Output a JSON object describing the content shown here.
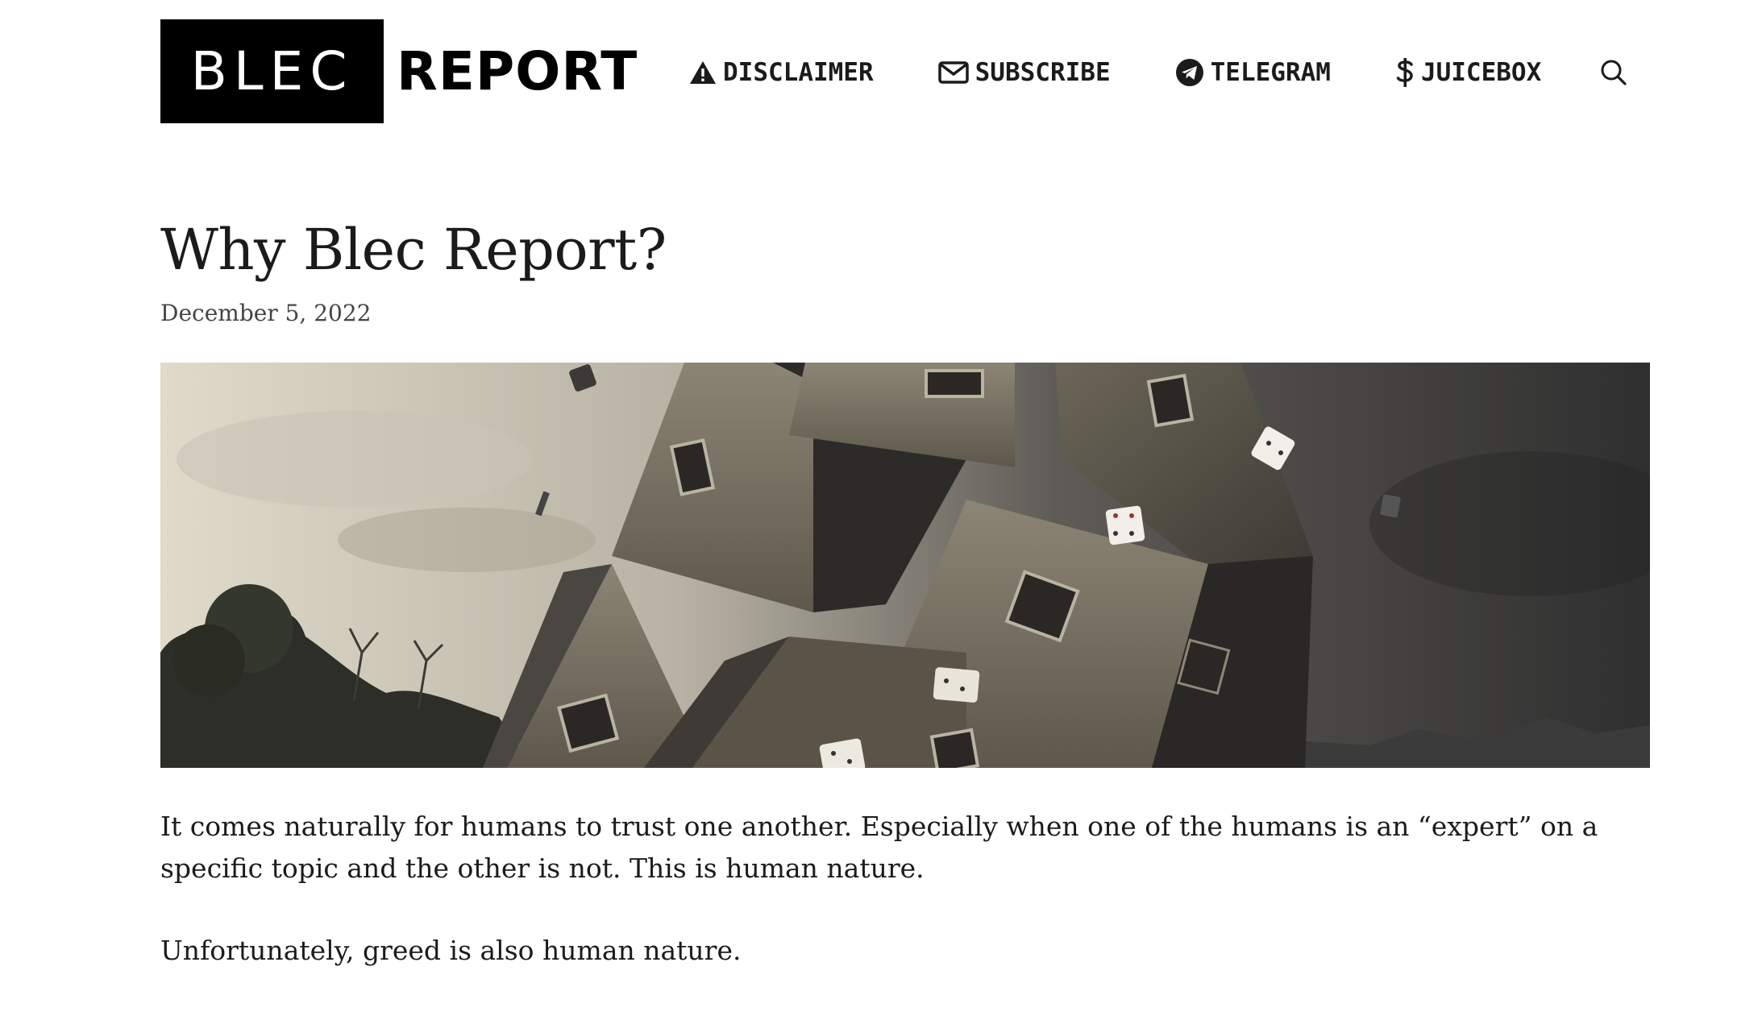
{
  "site": {
    "logo_left": "BLEC",
    "logo_right": "REPORT"
  },
  "nav": {
    "items": [
      {
        "label": "DISCLAIMER",
        "icon": "warning-icon"
      },
      {
        "label": "SUBSCRIBE",
        "icon": "envelope-icon"
      },
      {
        "label": "TELEGRAM",
        "icon": "telegram-icon"
      },
      {
        "label": "JUICEBOX",
        "icon": "dollar-icon"
      }
    ],
    "search_icon": "search-icon"
  },
  "article": {
    "title": "Why Blec Report?",
    "date": "December 5, 2022",
    "featured_image": {
      "palette": {
        "sky_light": "#d9d3c5",
        "sky_dark": "#3a3a3a",
        "house_wall": "#7a7466",
        "house_shadow": "#2b2926",
        "roof": "#4a4743"
      }
    },
    "paragraphs": [
      "It comes naturally for humans to trust one another. Especially when one of the humans is an “expert” on a specific topic and the other is not. This is human nature.",
      "Unfortunately, greed is also human nature."
    ]
  }
}
